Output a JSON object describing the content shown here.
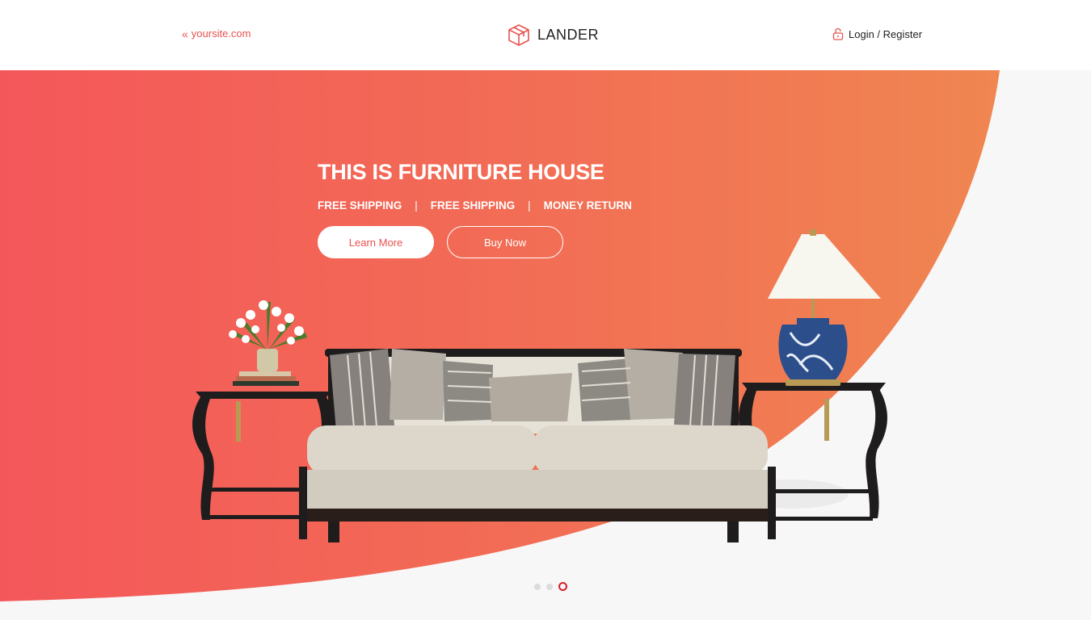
{
  "header": {
    "back_link": "yoursite.com",
    "logo_text": "LANDER",
    "login_link": "Login / Register"
  },
  "hero": {
    "title": "THIS IS FURNITURE HOUSE",
    "features": [
      "FREE SHIPPING",
      "FREE SHIPPING",
      "MONEY RETURN"
    ],
    "separator": "|",
    "learn_more": "Learn More",
    "buy_now": "Buy Now"
  },
  "carousel": {
    "slide_count": 3,
    "active_slide": 3
  },
  "colors": {
    "accent": "#e8534f",
    "gradient_start": "#f4575a",
    "gradient_end": "#f08651",
    "active_dot": "#d8202a"
  },
  "icons": {
    "back": "double-chevron-left-icon",
    "logo": "box-icon",
    "login": "lock-icon"
  }
}
